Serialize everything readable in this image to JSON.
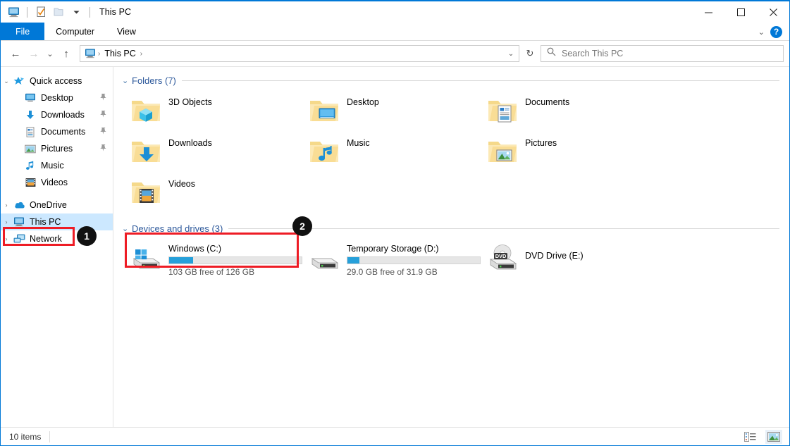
{
  "window": {
    "title": "This PC",
    "quick_access_toolbar": [
      {
        "name": "this-pc-icon",
        "label": "This PC"
      },
      {
        "name": "properties-icon",
        "label": "Properties"
      },
      {
        "name": "new-folder-icon",
        "label": "New folder"
      },
      {
        "name": "customize-qat-dropdown",
        "label": "Customize Quick Access Toolbar"
      }
    ],
    "controls": {
      "minimize": "—",
      "maximize": "□",
      "close": "✕"
    }
  },
  "ribbon": {
    "tabs": [
      {
        "label": "File",
        "active": true
      },
      {
        "label": "Computer",
        "active": false
      },
      {
        "label": "View",
        "active": false
      }
    ],
    "collapse_label": "⌄",
    "help_label": "?"
  },
  "address": {
    "back": "←",
    "forward": "→",
    "recent": "⌄",
    "up": "↑",
    "breadcrumb": [
      "This PC"
    ],
    "separator": "›",
    "dropdown": "⌄",
    "refresh": "↻"
  },
  "search": {
    "placeholder": "Search This PC",
    "icon": "search-icon"
  },
  "sidebar": {
    "items": [
      {
        "label": "Quick access",
        "icon": "pin-star-icon",
        "chevron": "⌄",
        "indent": false,
        "pinned": false,
        "selected": false
      },
      {
        "label": "Desktop",
        "icon": "desktop-icon",
        "chevron": "",
        "indent": true,
        "pinned": true,
        "selected": false
      },
      {
        "label": "Downloads",
        "icon": "downloads-icon",
        "chevron": "",
        "indent": true,
        "pinned": true,
        "selected": false
      },
      {
        "label": "Documents",
        "icon": "documents-icon",
        "chevron": "",
        "indent": true,
        "pinned": true,
        "selected": false
      },
      {
        "label": "Pictures",
        "icon": "pictures-icon",
        "chevron": "",
        "indent": true,
        "pinned": true,
        "selected": false
      },
      {
        "label": "Music",
        "icon": "music-icon",
        "chevron": "",
        "indent": true,
        "pinned": false,
        "selected": false
      },
      {
        "label": "Videos",
        "icon": "videos-icon",
        "chevron": "",
        "indent": true,
        "pinned": false,
        "selected": false
      },
      {
        "label": "OneDrive",
        "icon": "onedrive-icon",
        "chevron": "›",
        "indent": false,
        "pinned": false,
        "selected": false
      },
      {
        "label": "This PC",
        "icon": "this-pc-icon",
        "chevron": "›",
        "indent": false,
        "pinned": false,
        "selected": true
      },
      {
        "label": "Network",
        "icon": "network-icon",
        "chevron": "›",
        "indent": false,
        "pinned": false,
        "selected": false
      }
    ]
  },
  "main": {
    "groups": [
      {
        "title": "Folders (7)",
        "chevron": "⌄",
        "items": [
          {
            "name": "3D Objects",
            "icon": "folder-3d-objects-icon"
          },
          {
            "name": "Desktop",
            "icon": "folder-desktop-icon"
          },
          {
            "name": "Documents",
            "icon": "folder-documents-icon"
          },
          {
            "name": "Downloads",
            "icon": "folder-downloads-icon"
          },
          {
            "name": "Music",
            "icon": "folder-music-icon"
          },
          {
            "name": "Pictures",
            "icon": "folder-pictures-icon"
          },
          {
            "name": "Videos",
            "icon": "folder-videos-icon"
          }
        ]
      },
      {
        "title": "Devices and drives (3)",
        "chevron": "⌄",
        "drives": [
          {
            "name": "Windows (C:)",
            "icon": "windows-drive-icon",
            "free_text": "103 GB free of 126 GB",
            "free_gb": 103,
            "total_gb": 126,
            "used_percent": 18,
            "bar_color": "#26a0da",
            "has_bar": true
          },
          {
            "name": "Temporary Storage (D:)",
            "icon": "hard-drive-icon",
            "free_text": "29.0 GB free of 31.9 GB",
            "free_gb": 29.0,
            "total_gb": 31.9,
            "used_percent": 9,
            "bar_color": "#26a0da",
            "has_bar": true
          },
          {
            "name": "DVD Drive (E:)",
            "icon": "dvd-drive-icon",
            "free_text": "",
            "has_bar": false
          }
        ]
      }
    ]
  },
  "status": {
    "item_count": "10 items",
    "views": [
      {
        "name": "details-view-button",
        "label": "Details view",
        "active": false
      },
      {
        "name": "large-icons-view-button",
        "label": "Large icons view",
        "active": true
      }
    ]
  },
  "annotations": [
    {
      "number": "1",
      "target": "sidebar-item-this-pc"
    },
    {
      "number": "2",
      "target": "drive-windows-c"
    }
  ],
  "colors": {
    "accent": "#0078d7",
    "selection": "#cce8ff",
    "group_header": "#2b579a",
    "progress": "#26a0da",
    "annotation": "#ee1c25"
  }
}
